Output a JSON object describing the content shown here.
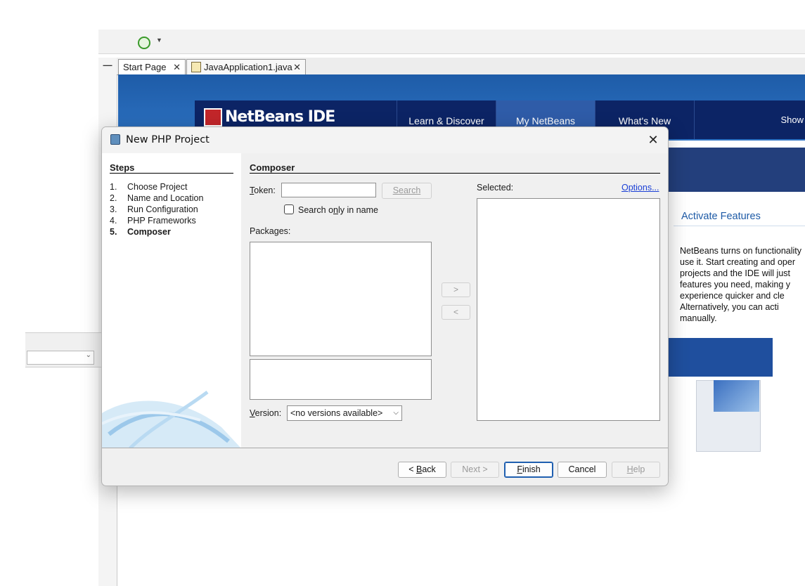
{
  "ide": {
    "tabs": [
      {
        "label": "Start Page",
        "close": "✕"
      },
      {
        "label": "JavaApplication1.java",
        "close": "✕"
      }
    ],
    "minimize": "—",
    "start_page": {
      "logo": "NetBeans IDE",
      "nav": [
        "Learn & Discover",
        "My NetBeans",
        "What's New",
        "Show"
      ],
      "activate_title": "Activate Features",
      "activate_text": "NetBeans turns on functionality\nuse it. Start creating and oper\nprojects and the IDE will just\nfeatures you need, making y\nexperience quicker and cle\nAlternatively, you can acti\nmanually."
    }
  },
  "dialog": {
    "title": "New PHP Project",
    "close_glyph": "✕",
    "steps": {
      "title": "Steps",
      "items": [
        {
          "num": "1.",
          "label": "Choose Project"
        },
        {
          "num": "2.",
          "label": "Name and Location"
        },
        {
          "num": "3.",
          "label": "Run Configuration"
        },
        {
          "num": "4.",
          "label": "PHP Frameworks"
        },
        {
          "num": "5.",
          "label": "Composer"
        }
      ],
      "current_index": 4
    },
    "composer": {
      "title": "Composer",
      "token_label_u": "T",
      "token_label_rest": "oken:",
      "token_value": "",
      "search_button": "Search",
      "search_only_prefix": "Search o",
      "search_only_u": "n",
      "search_only_rest": "ly in name",
      "search_only_checked": false,
      "packages_label": "Packages:",
      "selected_label": "Selected:",
      "options_link": "Options...",
      "add_button": ">",
      "remove_button": "<",
      "version_label_u": "V",
      "version_label_rest": "ersion:",
      "version_value": "<no versions available>"
    },
    "footer": {
      "back_prefix": "< ",
      "back_u": "B",
      "back_rest": "ack",
      "next": "Next >",
      "finish_u": "F",
      "finish_rest": "inish",
      "cancel": "Cancel",
      "help_u": "H",
      "help_rest": "elp"
    }
  }
}
